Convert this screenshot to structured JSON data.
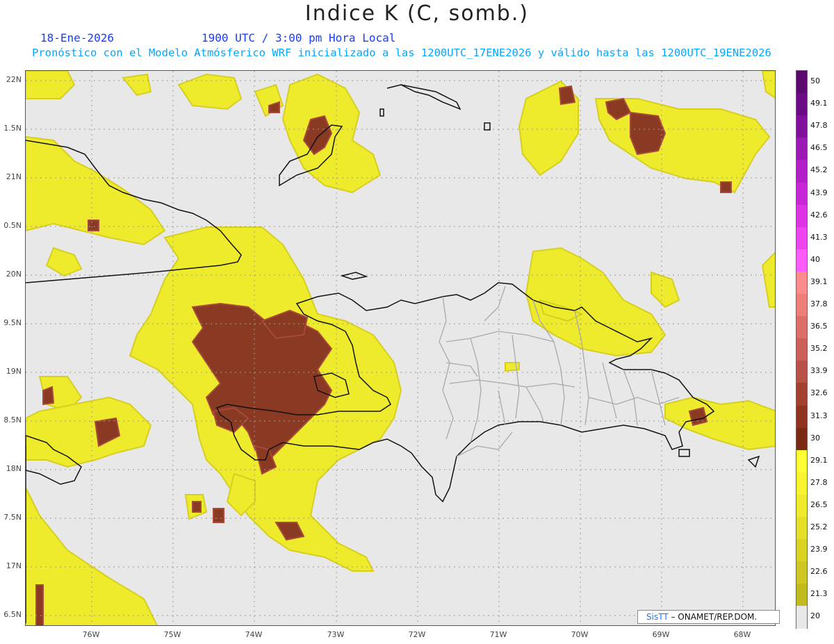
{
  "header": {
    "title": "Indice K (C, somb.)",
    "date": "18-Ene-2026",
    "time": "1900 UTC / 3:00 pm Hora Local",
    "subtitle": "Pronóstico con el Modelo Atmósferico WRF inicializado a las 1200UTC_17ENE2026 y válido hasta las  1200UTC_19ENE2026"
  },
  "axes": {
    "lat_labels": [
      "22N",
      "1.5N",
      "21N",
      "0.5N",
      "20N",
      "9.5N",
      "19N",
      "8.5N",
      "18N",
      "7.5N",
      "17N",
      "6.5N"
    ],
    "lon_labels": [
      "76W",
      "75W",
      "74W",
      "73W",
      "72W",
      "71W",
      "70W",
      "69W",
      "68W"
    ]
  },
  "colorbar": {
    "labels": [
      "50",
      "49.1",
      "47.8",
      "46.5",
      "45.2",
      "43.9",
      "42.6",
      "41.3",
      "40",
      "39.1",
      "37.8",
      "36.5",
      "35.2",
      "33.9",
      "32.6",
      "31.3",
      "30",
      "29.1",
      "27.8",
      "26.5",
      "25.2",
      "23.9",
      "22.6",
      "21.3",
      "20"
    ],
    "colors": [
      "#5a0a6e",
      "#6b0a85",
      "#80109c",
      "#9a18b4",
      "#b21fc8",
      "#c827d8",
      "#dc33e4",
      "#ee44f0",
      "#ff5cff",
      "#ff8c8c",
      "#ee7e78",
      "#dd6e66",
      "#cc6056",
      "#b85146",
      "#a3402f",
      "#8f3320",
      "#7a2a14",
      "#ffff33",
      "#f7f430",
      "#eeea2c",
      "#e4df28",
      "#d9d324",
      "#cec721",
      "#c2bb1d",
      "#e8e8e8"
    ]
  },
  "credit": {
    "brand": "SisTT",
    "org": "– ONAMET/REP.DOM."
  },
  "colors": {
    "background": "#e8e8e8",
    "yellow": "#f2ef2c",
    "olive": "#c9c21e",
    "brown": "#8a3a22",
    "brownLight": "#a8493a",
    "coast": "#111111",
    "border": "#a9a9a9"
  }
}
